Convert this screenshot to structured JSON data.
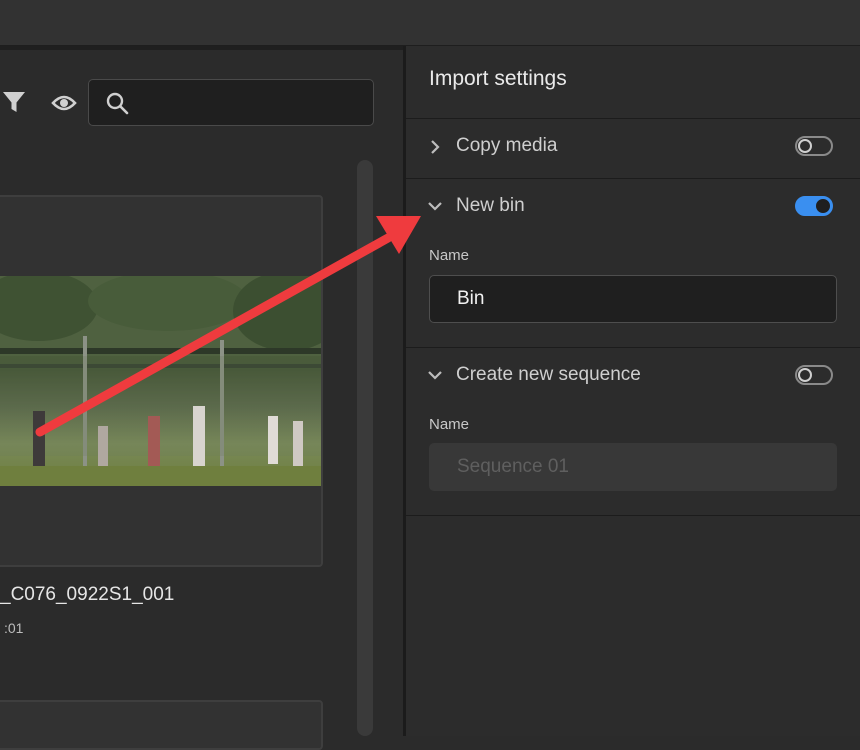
{
  "browser": {
    "icons": {
      "filter": "filter-icon",
      "visibility": "eye-icon",
      "search": "search-icon"
    },
    "search": {
      "value": ""
    },
    "clip": {
      "name": "_C076_0922S1_001",
      "duration": ":01"
    }
  },
  "import_settings": {
    "title": "Import settings",
    "copy_media": {
      "label": "Copy media",
      "enabled": false
    },
    "new_bin": {
      "label": "New bin",
      "enabled": true,
      "name_label": "Name",
      "name_value": "Bin"
    },
    "new_sequence": {
      "label": "Create new sequence",
      "enabled": false,
      "name_label": "Name",
      "name_placeholder": "Sequence 01"
    }
  },
  "annotation": {
    "arrow_color": "#ef3b3e"
  },
  "colors": {
    "toggle_on": "#3a8ff0",
    "panel_bg": "#2c2c2c"
  }
}
